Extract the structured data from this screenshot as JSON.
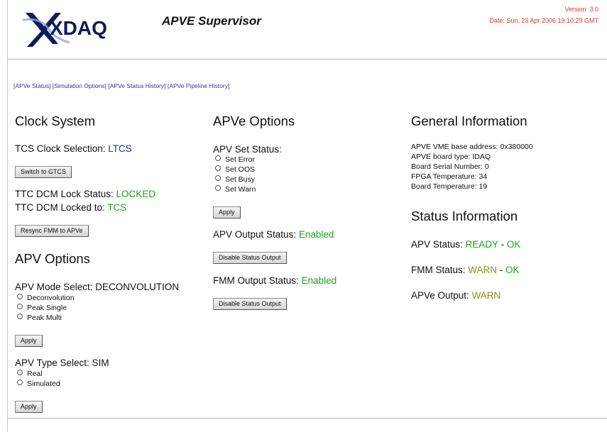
{
  "header": {
    "logo_text": "XDAQ",
    "title": "APVE Supervisor",
    "version": "Version: 3.0",
    "date": "Date: Sun, 23 Apr 2006 19:10:29 GMT"
  },
  "nav": [
    "[APVe Status]",
    "[Simulation Options]",
    "[APVe Status History]",
    "[APVe Pipeline History]"
  ],
  "clock": {
    "heading": "Clock System",
    "tcs_label": "TCS Clock Selection: ",
    "tcs_value": "LTCS",
    "switch_button": "Switch to GTCS",
    "dcm_lock_label": "TTC DCM Lock Status: ",
    "dcm_lock_value": "LOCKED",
    "dcm_locked_to_label": "TTC DCM Locked to: ",
    "dcm_locked_to_value": "TCS",
    "resync_button": "Resync FMM to APVe"
  },
  "apv_options": {
    "heading": "APV Options",
    "mode_label": "APV Mode Select: DECONVOLUTION",
    "mode_options": [
      "Deconvolution",
      "Peak Single",
      "Peak Multi"
    ],
    "mode_apply": "Apply",
    "type_label": "APV Type Select: SIM",
    "type_options": [
      "Real",
      "Simulated"
    ],
    "type_apply": "Apply"
  },
  "apve_options": {
    "heading": "APVe Options",
    "set_status_label": "APV Set Status:",
    "set_status_options": [
      "Set Error",
      "Set OOS",
      "Set Busy",
      "Set Warn"
    ],
    "apply": "Apply",
    "apv_output_label": "APV Output Status: ",
    "apv_output_value": "Enabled",
    "apv_output_button": "Disable Status Output",
    "fmm_output_label": "FMM Output Status: ",
    "fmm_output_value": "Enabled",
    "fmm_output_button": "Disable Status Output"
  },
  "general": {
    "heading": "General Information",
    "lines": [
      "APVE VME base address: 0x380000",
      "APVE board type: IDAQ",
      "Board Serial Number: 0",
      "FPGA Temperature: 34",
      "Board Temperature: 19"
    ]
  },
  "status": {
    "heading": "Status Information",
    "apv_label": "APV Status: ",
    "apv_state": "READY",
    "apv_sep": " - ",
    "apv_ok": "OK",
    "fmm_label": "FMM Status: ",
    "fmm_state": "WARN",
    "fmm_sep": " - ",
    "fmm_ok": "OK",
    "apve_output_label": "APVe Output: ",
    "apve_output_value": "WARN"
  },
  "colors": {
    "blue_value": "#1f2f9a",
    "green_value": "#22a022",
    "warn_value": "#8f8f1a",
    "header_red": "#d23a2a",
    "link": "#3333a0"
  }
}
